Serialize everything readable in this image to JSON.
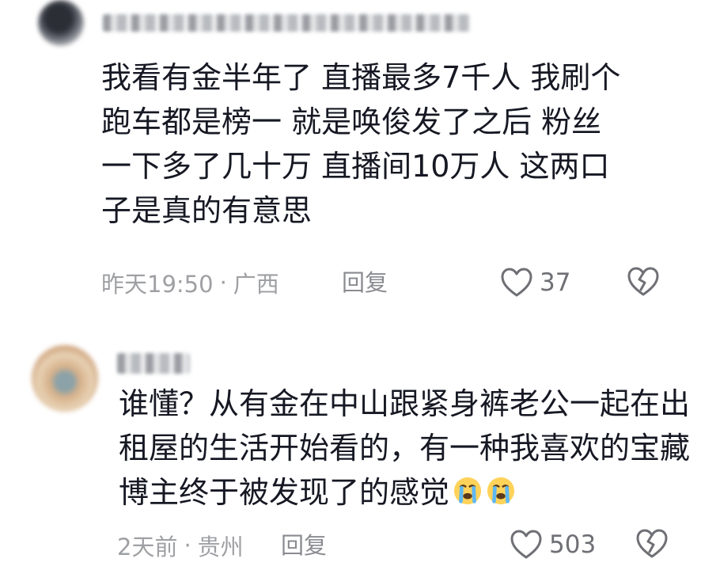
{
  "comments": [
    {
      "username": "",
      "text_lines": [
        "我看有金半年了 直播最多7千人 我刷个",
        "跑车都是榜一 就是唤俊发了之后 粉丝",
        "一下多了几十万 直播间10万人 这两口",
        "子是真的有意思"
      ],
      "time": "昨天19:50",
      "separator": "·",
      "location": "广西",
      "reply_label": "回复",
      "likes": "37"
    },
    {
      "username": "",
      "text_lines": [
        "谁懂？从有金在中山跟紧身裤老公一起在出",
        "租屋的生活开始看的，有一种我喜欢的宝藏",
        "博主终于被发现了的感觉"
      ],
      "emojis": [
        "crying-face",
        "crying-face"
      ],
      "time": "2天前",
      "separator": "·",
      "location": "贵州",
      "reply_label": "回复",
      "likes": "503"
    }
  ],
  "colors": {
    "text": "#161823",
    "meta": "#9fa0a4",
    "icon": "#6f7075",
    "emoji_face": "#ffd35a",
    "emoji_tear": "#5fb8f2"
  }
}
